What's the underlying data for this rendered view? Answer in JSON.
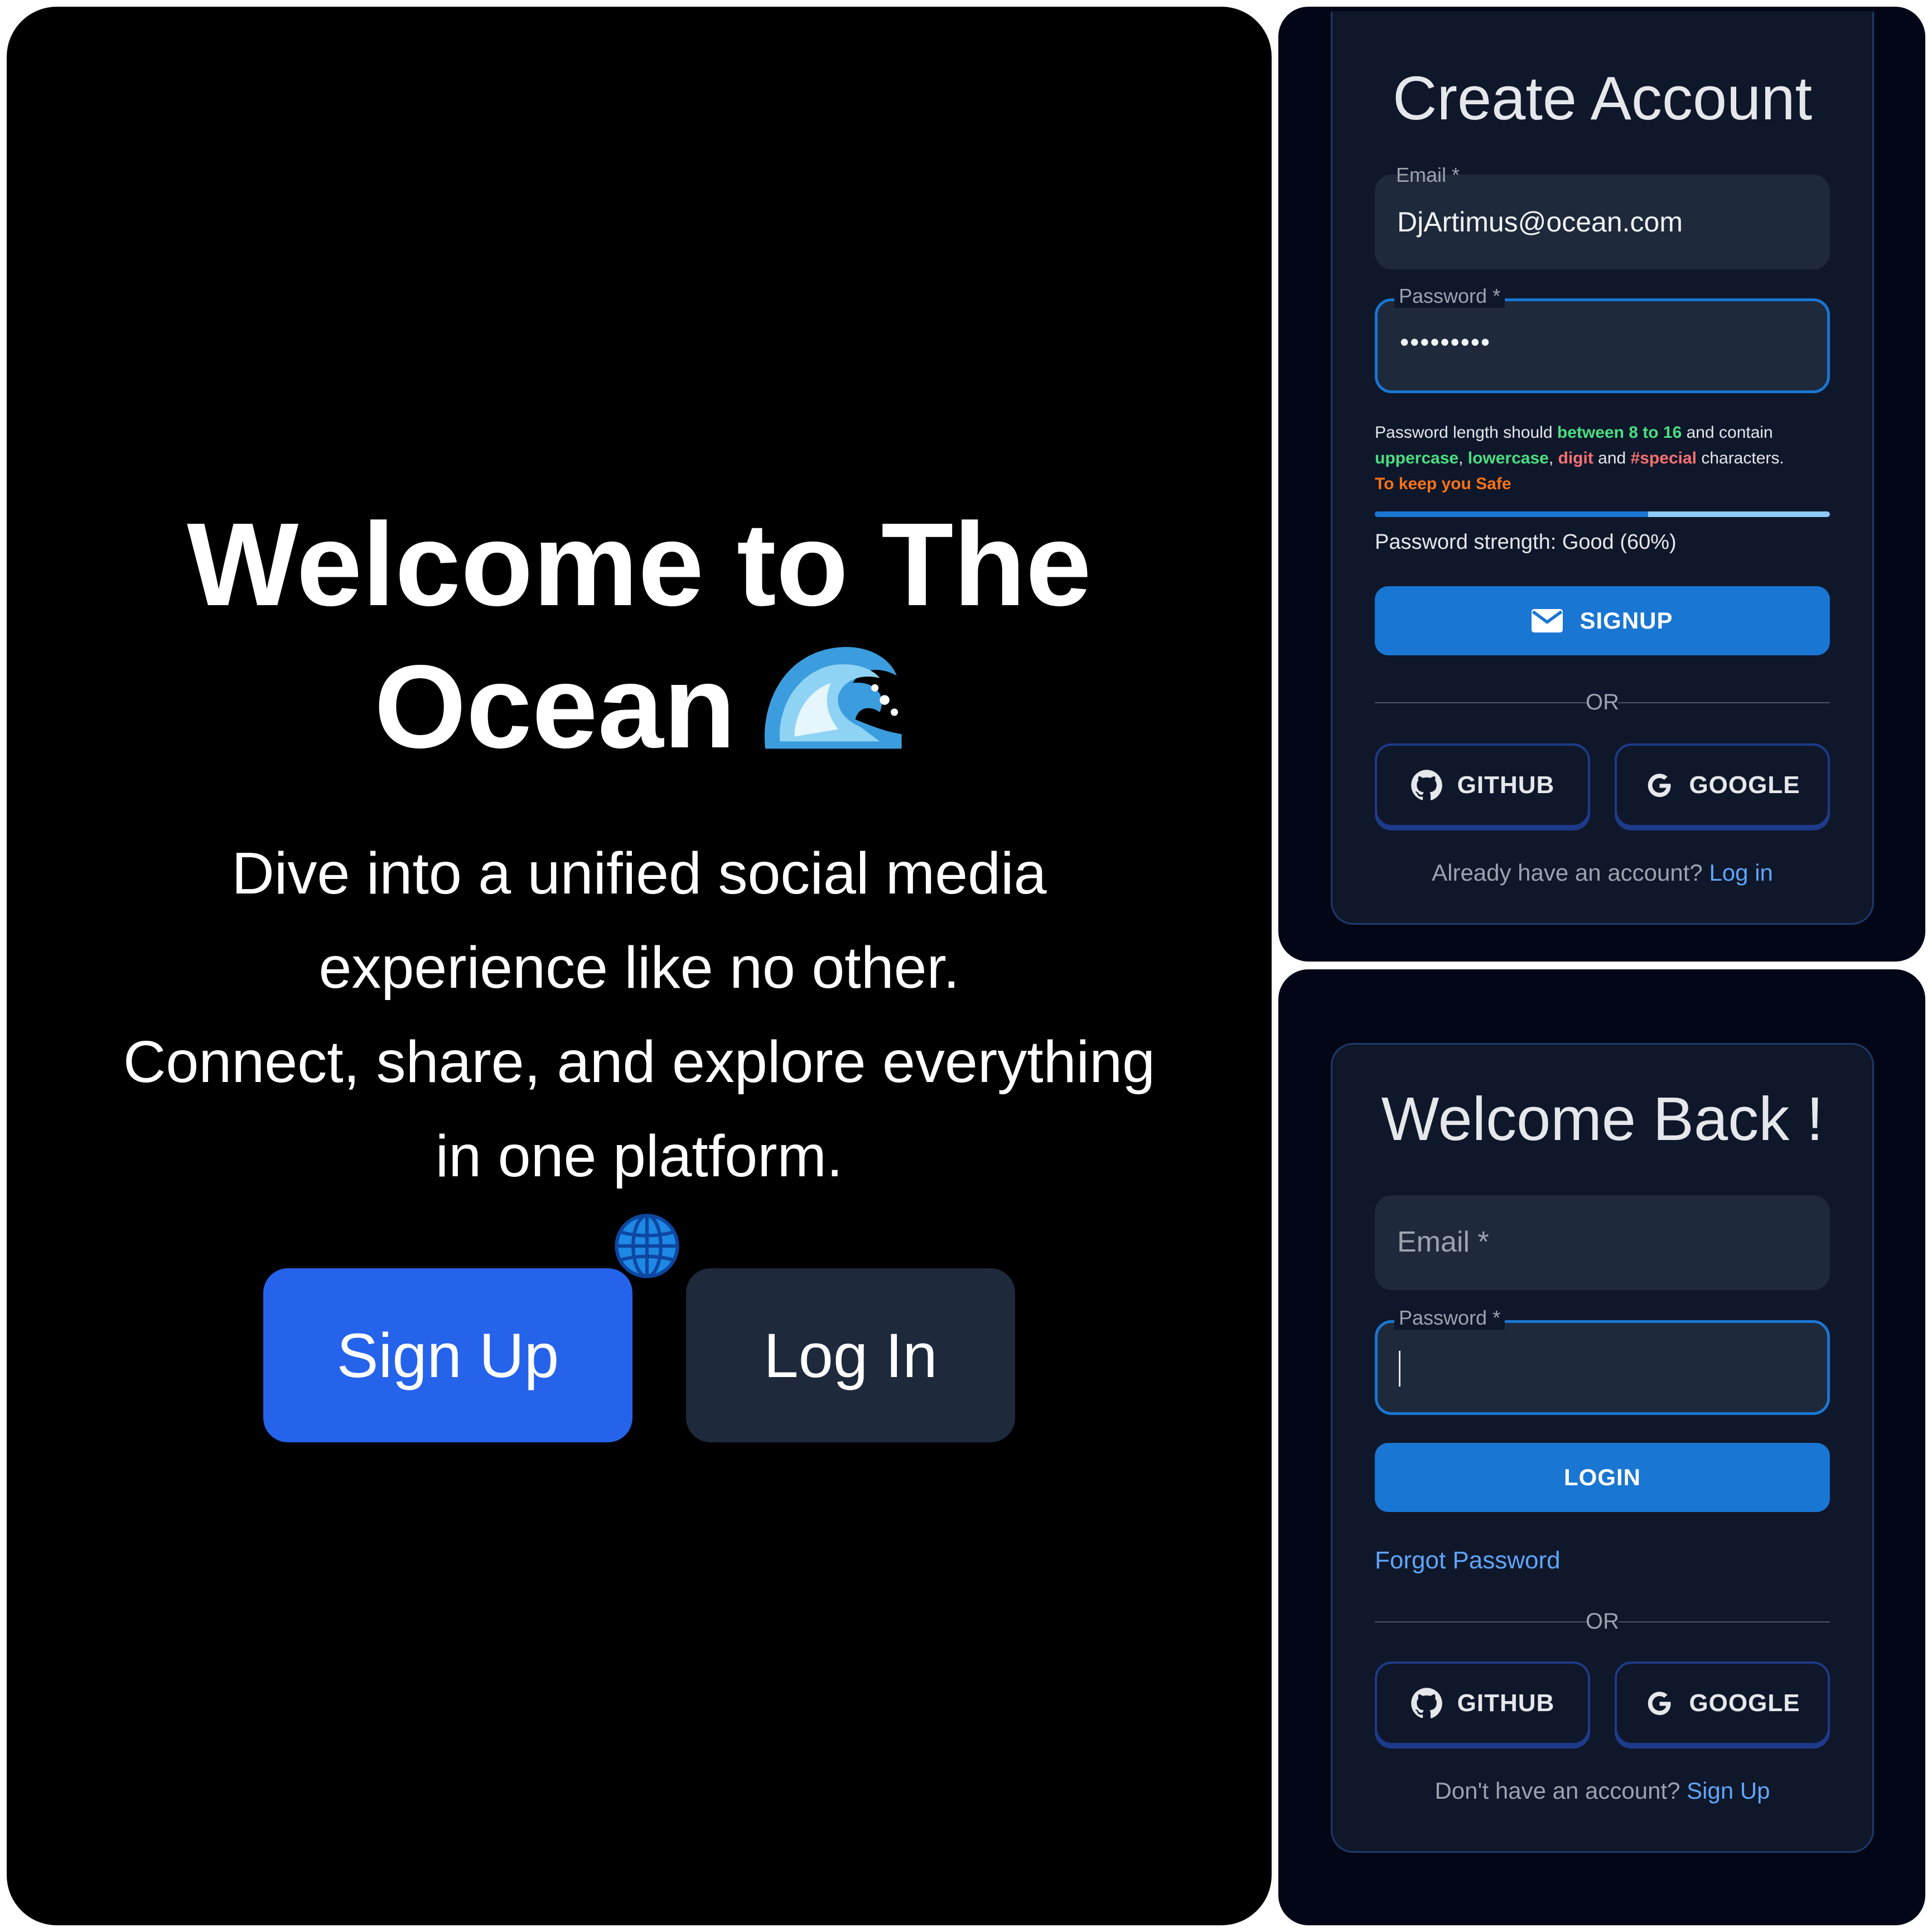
{
  "landing": {
    "title_line1": "Welcome to The",
    "title_line2": "Ocean",
    "title_emoji_icon": "wave-icon",
    "subtitle_lines": [
      "Dive into a unified social media",
      "experience like no other.",
      "Connect, share, and explore everything",
      "in one platform."
    ],
    "subtitle_emoji_icon": "globe-icon",
    "signup_label": "Sign Up",
    "login_label": "Log In"
  },
  "signup_form": {
    "title": "Create Account",
    "email_label": "Email *",
    "email_value": "DjArtimus@ocean.com",
    "password_label": "Password *",
    "password_value": "•••••••••",
    "hint": {
      "t1": "Password length should ",
      "t2": "between 8 to 16",
      "t3": " and contain",
      "t4": "uppercase",
      "t5": ", ",
      "t6": "lowercase",
      "t7": ", ",
      "t8": "digit",
      "t9": " and ",
      "t10": "#special",
      "t11": " characters.",
      "t12": "To keep you Safe"
    },
    "strength_percent": 60,
    "strength_text": "Password strength: Good (60%)",
    "submit_label": "SIGNUP",
    "or_label": "OR",
    "github_label": "GITHUB",
    "google_label": "GOOGLE",
    "footer_text": "Already have an account? ",
    "footer_link": "Log in"
  },
  "login_form": {
    "title": "Welcome Back !",
    "email_placeholder": "Email  *",
    "password_label": "Password *",
    "submit_label": "LOGIN",
    "forgot_label": "Forgot Password",
    "or_label": "OR",
    "github_label": "GITHUB",
    "google_label": "GOOGLE",
    "footer_text": "Don't have an account? ",
    "footer_link": "Sign Up"
  },
  "colors": {
    "primary": "#2563eb",
    "mui_primary": "#1976d2",
    "panel_bg": "#0f172a",
    "page_bg": "#000000",
    "success": "#4ade80",
    "danger": "#f87171",
    "warning": "#f97316"
  }
}
